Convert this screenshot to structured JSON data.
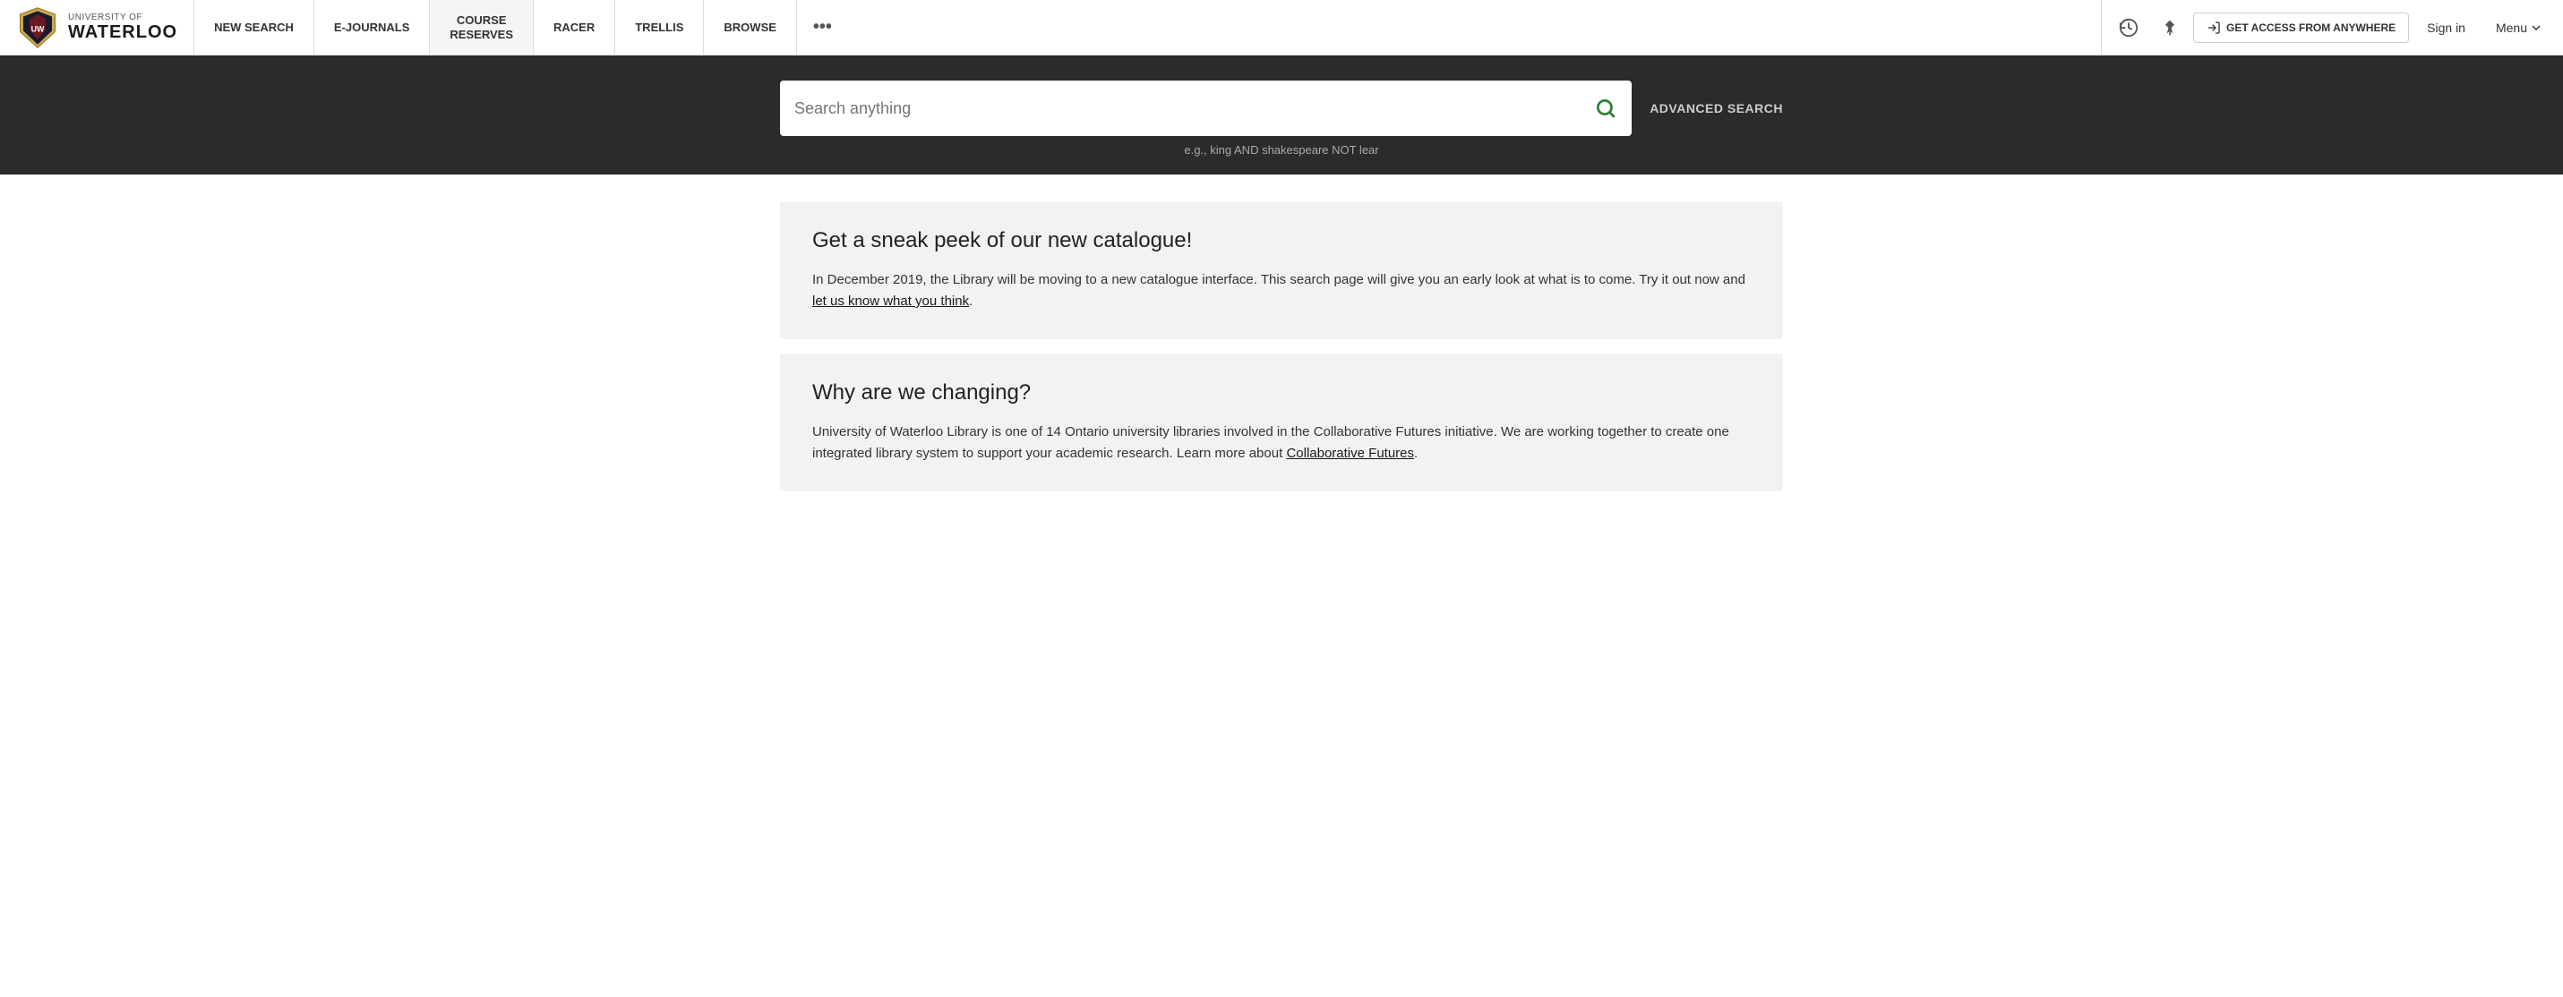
{
  "logo": {
    "univ_of": "UNIVERSITY OF",
    "name": "WATERLOO"
  },
  "nav": {
    "items": [
      {
        "id": "new-search",
        "label": "NEW SEARCH"
      },
      {
        "id": "e-journals",
        "label": "E-JOURNALS"
      },
      {
        "id": "course-reserves",
        "label": "COURSE\nRESERVES"
      },
      {
        "id": "racer",
        "label": "RACER"
      },
      {
        "id": "trellis",
        "label": "TRELLIS"
      },
      {
        "id": "browse",
        "label": "BROWSE"
      }
    ],
    "more_label": "•••",
    "get_access_label": "GET ACCESS FROM ANYWHERE",
    "sign_in_label": "Sign in",
    "menu_label": "Menu"
  },
  "search": {
    "placeholder": "Search anything",
    "hint": "e.g., king AND shakespeare NOT lear",
    "advanced_label": "ADVANCED SEARCH"
  },
  "cards": [
    {
      "id": "sneak-peek",
      "heading": "Get a sneak peek of our new catalogue!",
      "body_before": "In December 2019, the Library will be moving to a new catalogue interface. This search page will give you an early look at what is to come. Try it out now and ",
      "link_text": "let us know what you think",
      "body_after": "."
    },
    {
      "id": "why-changing",
      "heading": "Why are we changing?",
      "body_before": "University of Waterloo Library is one of 14 Ontario university libraries involved in the Collaborative Futures initiative. We are working together to create one integrated library system to support your academic research. Learn more about ",
      "link_text": "Collaborative Futures",
      "body_after": "."
    }
  ]
}
